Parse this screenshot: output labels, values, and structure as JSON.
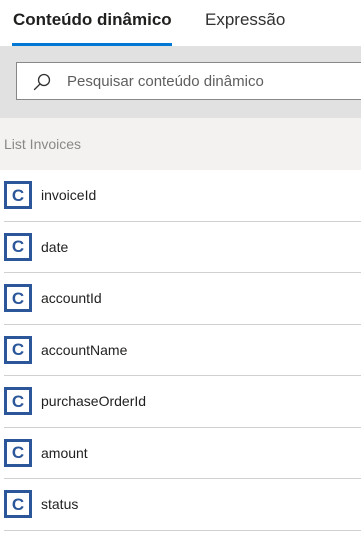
{
  "tabs": [
    {
      "label": "Conteúdo dinâmico",
      "selected": true
    },
    {
      "label": "Expressão",
      "selected": false
    }
  ],
  "search": {
    "placeholder": "Pesquisar conteúdo dinâmico",
    "value": ""
  },
  "section": {
    "title": "List Invoices"
  },
  "items": [
    {
      "label": "invoiceId",
      "icon": "C"
    },
    {
      "label": "date",
      "icon": "C"
    },
    {
      "label": "accountId",
      "icon": "C"
    },
    {
      "label": "accountName",
      "icon": "C"
    },
    {
      "label": "purchaseOrderId",
      "icon": "C"
    },
    {
      "label": "amount",
      "icon": "C"
    },
    {
      "label": "status",
      "icon": "C"
    }
  ],
  "colors": {
    "accent": "#0078d4",
    "connector_icon": "#2b579a",
    "search_band": "#e1e1e1",
    "section_header": "#f3f2f1"
  }
}
